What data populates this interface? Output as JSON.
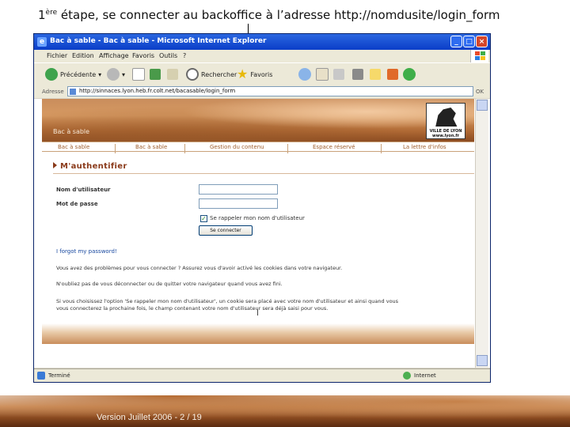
{
  "caption": {
    "step_num": "1",
    "step_sup": "ère",
    "text": " étape, se connecter au backoffice à l’adresse http://nomdusite/login_form"
  },
  "window": {
    "title": "Bac à sable - Bac à sable - Microsoft Internet Explorer",
    "controls": [
      "_",
      "□",
      "×"
    ]
  },
  "menubar": {
    "items": [
      "Fichier",
      "Edition",
      "Affichage",
      "Favoris",
      "Outils",
      "?"
    ]
  },
  "toolbar": {
    "back_label": "Précédente",
    "search_label": "Rechercher",
    "favorites_label": "Favoris"
  },
  "addressbar": {
    "label": "Adresse",
    "url": "http://sinnaces.lyon.heb.fr.colt.net/bacasable/login_form",
    "go_label": "OK"
  },
  "site": {
    "banner_label": "Bac à sable",
    "logo_caption_line1": "VILLE DE LYON",
    "logo_caption_line2": "www.lyon.fr",
    "nav": [
      "Bac à sable",
      "Bac à sable",
      "Gestion du contenu",
      "Espace réservé",
      "La lettre d'infos"
    ],
    "heading": "M'authentifier",
    "username_label": "Nom d'utilisateur",
    "password_label": "Mot de passe",
    "remember_label": "Se rappeler mon nom d'utilisateur",
    "submit_label": "Se connecter",
    "forgot_label": "I forgot my password!",
    "para1": "Vous avez des problèmes pour vous connecter ? Assurez vous d'avoir activé les cookies dans votre navigateur.",
    "para2": "N'oubliez pas de vous déconnecter ou de quitter votre navigateur quand vous avez fini.",
    "para3a": "Si vous choisissez l'option 'Se rappeler mon nom d'utilisateur', un cookie sera placé avec votre nom d'utilisateur et ainsi quand vous",
    "para3b": "vous connecterez la prochaine fois, le champ contenant votre nom d'utilisateur sera déjà saisi pour vous."
  },
  "statusbar": {
    "status": "Terminé",
    "zone": "Internet"
  },
  "footer": {
    "text": "Version Juillet 2006 - 2 / 19"
  }
}
